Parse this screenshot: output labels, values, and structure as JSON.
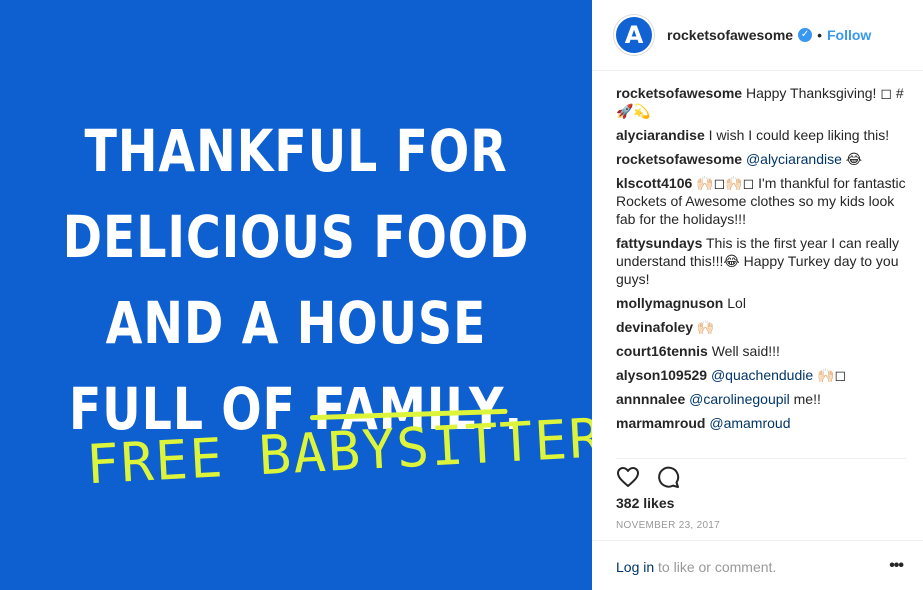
{
  "image": {
    "lines": [
      "THANKFUL FOR",
      "DELICIOUS FOOD",
      "AND A HOUSE"
    ],
    "last_line_prefix": "FULL OF ",
    "struck_word": "FAMILY",
    "last_line_suffix": ".",
    "scribble": "FREE BABYSITTERS.",
    "background_color": "#0e5fd0",
    "scribble_color": "#dcf53a"
  },
  "header": {
    "avatar_letter": "A",
    "username": "rocketsofawesome",
    "verified_icon": "check-icon",
    "separator": "•",
    "follow_label": "Follow"
  },
  "comments": [
    {
      "user": "rocketsofawesome",
      "text": "Happy Thanksgiving! ◻ #🚀💫"
    },
    {
      "user": "alyciarandise",
      "text": "I wish I could keep liking this!"
    },
    {
      "user": "rocketsofawesome",
      "mention": "@alyciarandise",
      "text": "😂"
    },
    {
      "user": "klscott4106",
      "text": "🙌🏻◻🙌🏻◻ I'm thankful for fantastic Rockets of Awesome clothes so my kids look fab for the holidays!!!"
    },
    {
      "user": "fattysundays",
      "text": "This is the first year I can really understand this!!!😂 Happy Turkey day to you guys!"
    },
    {
      "user": "mollymagnuson",
      "text": "Lol"
    },
    {
      "user": "devinafoley",
      "text": "🙌🏻"
    },
    {
      "user": "court16tennis",
      "text": "Well said!!!"
    },
    {
      "user": "alyson109529",
      "mention": "@quachendudie",
      "text": "🙌🏻◻"
    },
    {
      "user": "annnnalee",
      "mention": "@carolinegoupil",
      "text": "me!!"
    },
    {
      "user": "marmamroud",
      "mention": "@amamroud",
      "text": ""
    }
  ],
  "actions": {
    "like_icon": "heart-icon",
    "comment_icon": "comment-icon"
  },
  "likes": "382 likes",
  "date": "NOVEMBER 23, 2017",
  "footer": {
    "login_link": "Log in",
    "login_text": " to like or comment.",
    "more_icon": "more-icon",
    "more_glyph": "•••"
  }
}
